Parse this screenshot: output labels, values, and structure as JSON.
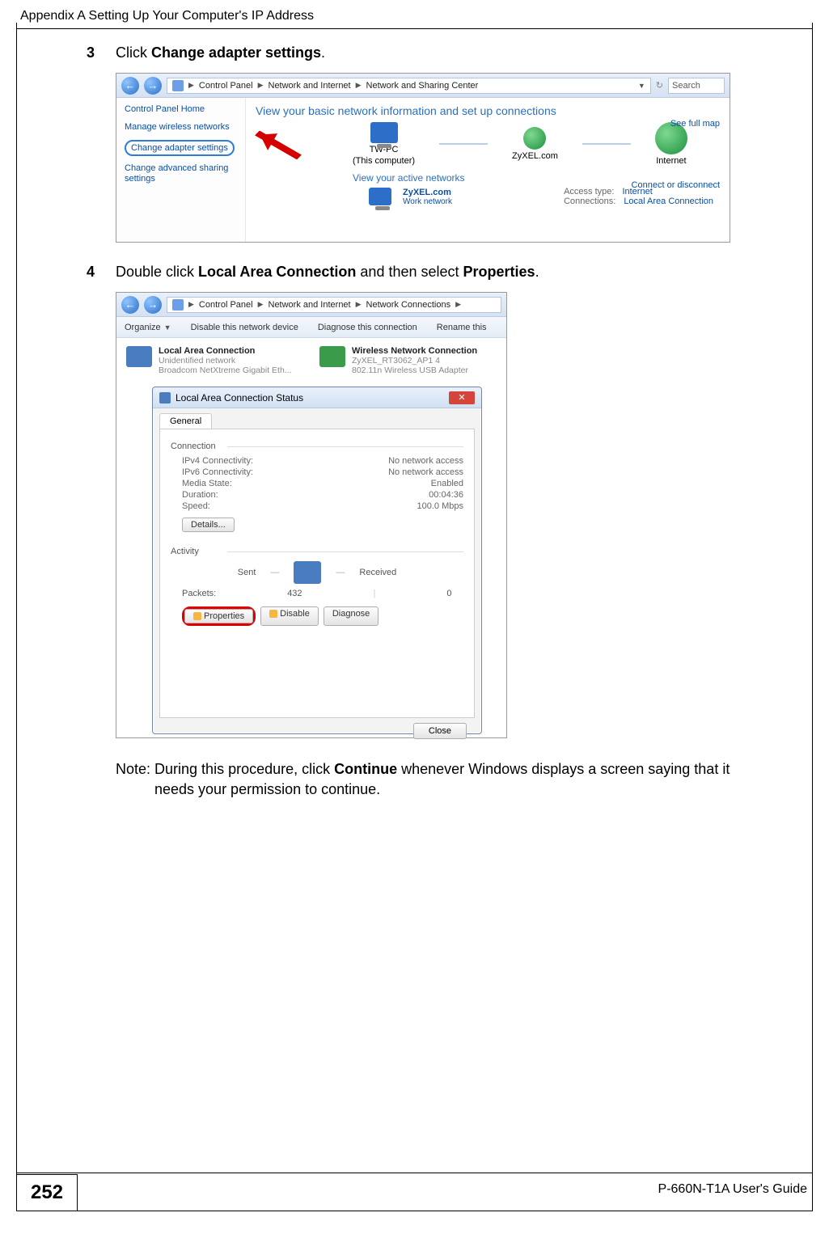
{
  "header": {
    "title": "Appendix A Setting Up Your Computer's IP Address"
  },
  "steps": {
    "s3": {
      "num": "3",
      "pre": "Click ",
      "bold": "Change adapter settings",
      "post": "."
    },
    "s4": {
      "num": "4",
      "pre": "Double click ",
      "bold1": "Local Area Connection",
      "mid": " and then select ",
      "bold2": "Properties",
      "post": "."
    }
  },
  "note": {
    "label": "Note: ",
    "pre": "During this procedure, click ",
    "bold": "Continue",
    "post": " whenever Windows displays a screen saying that it needs your permission to continue."
  },
  "ss1": {
    "breadcrumb": {
      "p1": "Control Panel",
      "p2": "Network and Internet",
      "p3": "Network and Sharing Center"
    },
    "search": "Search",
    "sidebar": {
      "home": "Control Panel Home",
      "l1": "Manage wireless networks",
      "l2": "Change adapter settings",
      "l3": "Change advanced sharing settings"
    },
    "banner": "View your basic network information and set up connections",
    "full_map": "See full map",
    "connect": "Connect or disconnect",
    "pc_name": "TW-PC",
    "pc_sub": "(This computer)",
    "mid_name": "ZyXEL.com",
    "inet": "Internet",
    "active": "View your active networks",
    "net_name": "ZyXEL.com",
    "net_sub": "Work network",
    "access_lbl": "Access type:",
    "access_val": "Internet",
    "conn_lbl": "Connections:",
    "conn_val": "Local Area Connection"
  },
  "ss2": {
    "breadcrumb": {
      "p1": "Control Panel",
      "p2": "Network and Internet",
      "p3": "Network Connections"
    },
    "toolbar": {
      "organize": "Organize",
      "disable": "Disable this network device",
      "diagnose": "Diagnose this connection",
      "rename": "Rename this"
    },
    "lac": {
      "name": "Local Area Connection",
      "sub1": "Unidentified network",
      "sub2": "Broadcom NetXtreme Gigabit Eth..."
    },
    "wnc": {
      "name": "Wireless Network Connection",
      "sub1": "ZyXEL_RT3062_AP1  4",
      "sub2": "802.11n Wireless USB Adapter"
    },
    "dlg": {
      "title": "Local Area Connection Status",
      "tab": "General",
      "conn_title": "Connection",
      "rows": {
        "ipv4_l": "IPv4 Connectivity:",
        "ipv4_v": "No network access",
        "ipv6_l": "IPv6 Connectivity:",
        "ipv6_v": "No network access",
        "media_l": "Media State:",
        "media_v": "Enabled",
        "dur_l": "Duration:",
        "dur_v": "00:04:36",
        "speed_l": "Speed:",
        "speed_v": "100.0 Mbps"
      },
      "details": "Details...",
      "activity_title": "Activity",
      "sent": "Sent",
      "received": "Received",
      "packets_l": "Packets:",
      "packets_sent": "432",
      "packets_recv": "0",
      "btn_props": "Properties",
      "btn_disable": "Disable",
      "btn_diag": "Diagnose",
      "btn_close": "Close"
    }
  },
  "footer": {
    "page": "252",
    "guide": "P-660N-T1A User's Guide"
  }
}
